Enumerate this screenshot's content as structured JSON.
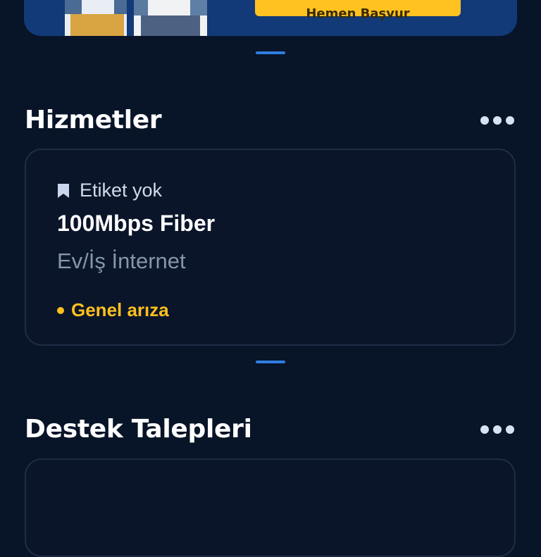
{
  "banner": {
    "cta_label": "Hemen Başvur"
  },
  "services": {
    "title": "Hizmetler",
    "more_icon": "more-horizontal-icon",
    "card": {
      "tag_icon": "bookmark-icon",
      "tag_label": "Etiket yok",
      "name": "100Mbps Fiber",
      "type": "Ev/İş İnternet",
      "status": "Genel arıza",
      "status_color": "#ffbf1f"
    }
  },
  "support": {
    "title": "Destek Talepleri",
    "more_icon": "more-horizontal-icon"
  },
  "colors": {
    "background": "#081427",
    "accent": "#2f7de1",
    "cta": "#ffc220"
  }
}
